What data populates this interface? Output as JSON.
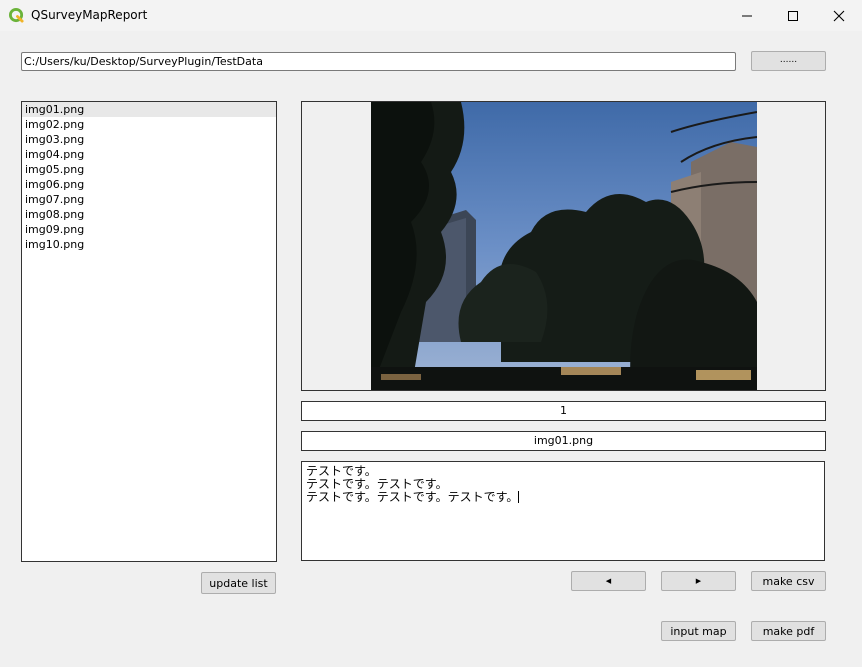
{
  "window": {
    "title": "QSurveyMapReport",
    "minimize_icon": "minimize-icon",
    "maximize_icon": "maximize-icon",
    "close_icon": "close-icon"
  },
  "path": {
    "value": "C:/Users/ku/Desktop/SurveyPlugin/TestData",
    "browse_label": "......"
  },
  "files": {
    "items": [
      "img01.png",
      "img02.png",
      "img03.png",
      "img04.png",
      "img05.png",
      "img06.png",
      "img07.png",
      "img08.png",
      "img09.png",
      "img10.png"
    ],
    "selected_index": 0
  },
  "viewer": {
    "index": "1",
    "filename": "img01.png"
  },
  "memo": {
    "lines": [
      "テストです。",
      "テストです。テストです。",
      "テストです。テストです。テストです。"
    ]
  },
  "buttons": {
    "update_list": "update list",
    "prev": "◀",
    "next": "▶",
    "make_csv": "make csv",
    "input_map": "input map",
    "make_pdf": "make pdf"
  }
}
